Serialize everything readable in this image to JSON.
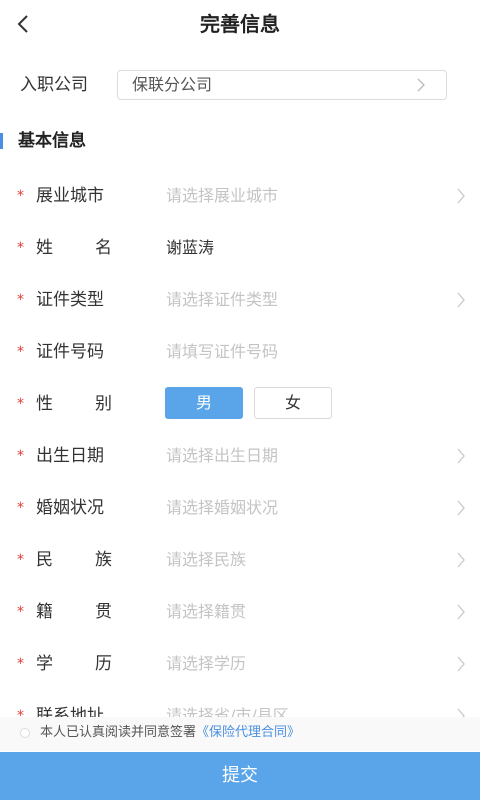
{
  "header": {
    "title": "完善信息"
  },
  "company": {
    "label": "入职公司",
    "value": "保联分公司"
  },
  "section": {
    "title": "基本信息"
  },
  "required_mark": "*",
  "fields": {
    "city": {
      "label": "展业城市",
      "placeholder": "请选择展业城市"
    },
    "name": {
      "label_a": "姓",
      "label_b": "名",
      "value": "谢蓝涛"
    },
    "id_type": {
      "label": "证件类型",
      "placeholder": "请选择证件类型"
    },
    "id_no": {
      "label": "证件号码",
      "placeholder": "请填写证件号码"
    },
    "gender": {
      "label_a": "性",
      "label_b": "别",
      "male": "男",
      "female": "女",
      "selected": "男"
    },
    "birth": {
      "label": "出生日期",
      "placeholder": "请选择出生日期"
    },
    "marital": {
      "label": "婚姻状况",
      "placeholder": "请选择婚姻状况"
    },
    "ethnic": {
      "label_a": "民",
      "label_b": "族",
      "placeholder": "请选择民族"
    },
    "native": {
      "label_a": "籍",
      "label_b": "贯",
      "placeholder": "请选择籍贯"
    },
    "education": {
      "label_a": "学",
      "label_b": "历",
      "placeholder": "请选择学历"
    },
    "address": {
      "label": "联系地址",
      "placeholder": "请选择省/市/县区"
    }
  },
  "agreement": {
    "text": "本人已认真阅读并同意签署",
    "link": "《保险代理合同》"
  },
  "submit": {
    "label": "提交"
  },
  "colors": {
    "accent": "#5aa5ea",
    "required": "#e53935",
    "link": "#4a90e2"
  }
}
